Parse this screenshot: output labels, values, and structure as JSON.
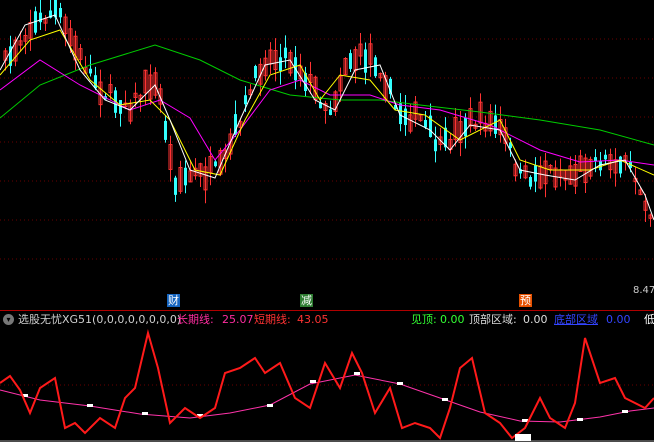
{
  "price_axis": {
    "low_label": "8.47"
  },
  "events": [
    {
      "label": "财",
      "bg": "#1565c0",
      "x": 0.265
    },
    {
      "label": "减",
      "bg": "#2e7d32",
      "x": 0.468
    },
    {
      "label": "预",
      "bg": "#e65100",
      "x": 0.803
    }
  ],
  "indicator": {
    "name": "选股无忧XG51(0,0,0,0,0,0,0,0)",
    "long_label": "长期线:",
    "long_value": "25.07",
    "short_label": "短期线:",
    "short_value": "43.05",
    "top_label": "见顶:",
    "top_value": "0.00",
    "top_zone_label": "顶部区域:",
    "top_zone_value": "0.00",
    "bottom_zone_label": "底部区域",
    "bottom_zone_value": "0.00",
    "low_label": "低"
  },
  "colors": {
    "up": "#ff3333",
    "down": "#33ffff",
    "ma_white": "#ffffff",
    "ma_yellow": "#ffff00",
    "ma_magenta": "#ff00ff",
    "ma_green": "#00cc00",
    "short_line": "#ff1a1a",
    "long_line": "#ff33aa",
    "grid": "#6a0000"
  }
}
